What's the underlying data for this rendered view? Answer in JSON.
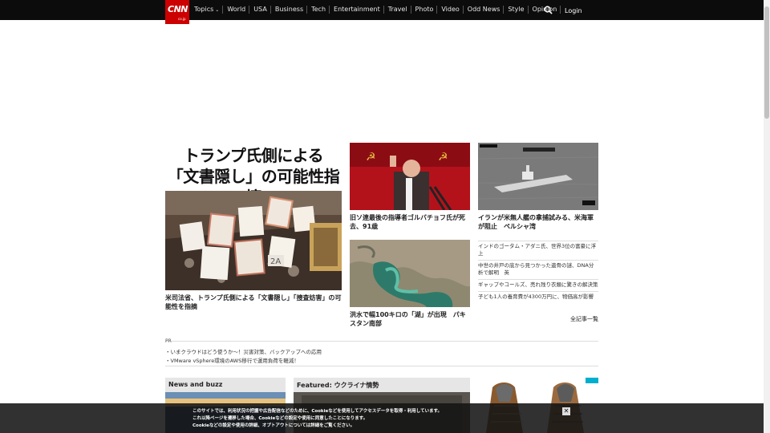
{
  "header": {
    "logo_text": "CNN",
    "logo_sub": "co.jp",
    "nav": [
      "Topics",
      "World",
      "USA",
      "Business",
      "Tech",
      "Entertainment",
      "Travel",
      "Photo",
      "Video",
      "Odd News",
      "Style",
      "Opinion"
    ],
    "login": "Login"
  },
  "main": {
    "headline_line1": "トランプ氏側による",
    "headline_line2": "「文書隠し」の可能性指摘",
    "lead_caption": "米司法省、トランプ氏側による「文書隠し」「捜査妨害」の可能性を指摘",
    "story2_caption": "旧ソ連最後の指導者ゴルバチョフ氏が死去、91歳",
    "story3_caption": "イランが米無人艦の拿捕試みる、米海軍が阻止　ペルシャ湾",
    "story4_caption": "洪水で幅100キロの「湖」が出現　パキスタン南部",
    "img_label": "2A"
  },
  "sidebar_list": [
    "インドのゴータム・アダニ氏、世界3位の富豪に浮上",
    "中世の井戸の底から見つかった遺骨の謎、DNA分析で解明　英",
    "ギャップやコールズ、売れ残り衣類に驚きの解決策",
    "子ども1人の養育費が4300万円に、物価高が影響"
  ],
  "more_link": "全記事一覧",
  "pr": {
    "label": "PR",
    "links": [
      "・いまクラウドはどう使うか～！災害対策、バックアップへの応用",
      "・VMware vSphere環境のAWS移行で運用負荷を軽減！"
    ]
  },
  "sections": {
    "news_buzz": "News and buzz",
    "featured": "Featured: ウクライナ情勢"
  },
  "cookie": {
    "line1": "このサイトでは、利用状況の把握や広告配信などのために、Cookieなどを使用してアクセスデータを取得・利用しています。",
    "line2": "これ以降ページを遷移した場合、Cookieなどの設定や使用に同意したことになります。",
    "line3": "Cookieなどの設定や使用の詳細、オプトアウトについては詳細をご覧ください。",
    "close": "✕"
  },
  "icons": {
    "search": "search-icon",
    "close": "close-icon",
    "caret": "chevron-down-icon"
  },
  "colors": {
    "brand": "#cc0000",
    "nav_bg": "#0c0c0c"
  }
}
